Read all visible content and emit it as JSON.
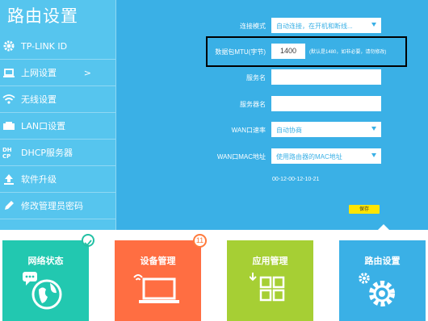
{
  "app_title": "路由设置",
  "sidebar": {
    "items": [
      {
        "label": "TP-LINK ID",
        "icon": "gear-icon"
      },
      {
        "label": "上网设置",
        "icon": "laptop-icon",
        "arrow": ">"
      },
      {
        "label": "无线设置",
        "icon": "wifi-icon"
      },
      {
        "label": "LAN口设置",
        "icon": "lan-port-icon"
      },
      {
        "label": "DHCP服务器",
        "icon": "dhcp-icon"
      },
      {
        "label": "软件升级",
        "icon": "upload-icon"
      },
      {
        "label": "修改管理员密码",
        "icon": "pencil-icon"
      }
    ]
  },
  "form": {
    "connect_mode": {
      "label": "连接模式",
      "value": "自动连接，在开机和断线..."
    },
    "mtu": {
      "label": "数据包MTU(字节)",
      "value": "1400",
      "hint": "(默认是1480，如非必要，请勿修改)"
    },
    "service_name": {
      "label": "服务名",
      "value": ""
    },
    "server_name": {
      "label": "服务器名",
      "value": ""
    },
    "wan_speed": {
      "label": "WAN口速率",
      "value": "自动协商"
    },
    "wan_mac": {
      "label": "WAN口MAC地址",
      "value": "使用路由器的MAC地址"
    },
    "mac_address": "00-12-00-12-10-21",
    "save_label": "保存"
  },
  "tiles": [
    {
      "label": "网络状态",
      "color": "#22c8b0",
      "icon": "globe-chat-icon",
      "badge": "check"
    },
    {
      "label": "设备管理",
      "color": "#ff6e42",
      "icon": "laptop-wifi-icon",
      "badge": "11"
    },
    {
      "label": "应用管理",
      "color": "#a6cf34",
      "icon": "apps-grid-icon"
    },
    {
      "label": "路由设置",
      "color": "#3ab0e6",
      "icon": "gears-icon",
      "active": true
    }
  ],
  "colors": {
    "primary": "#3ab0e6",
    "sidebar": "#56c5ee",
    "save": "#ffe500"
  }
}
